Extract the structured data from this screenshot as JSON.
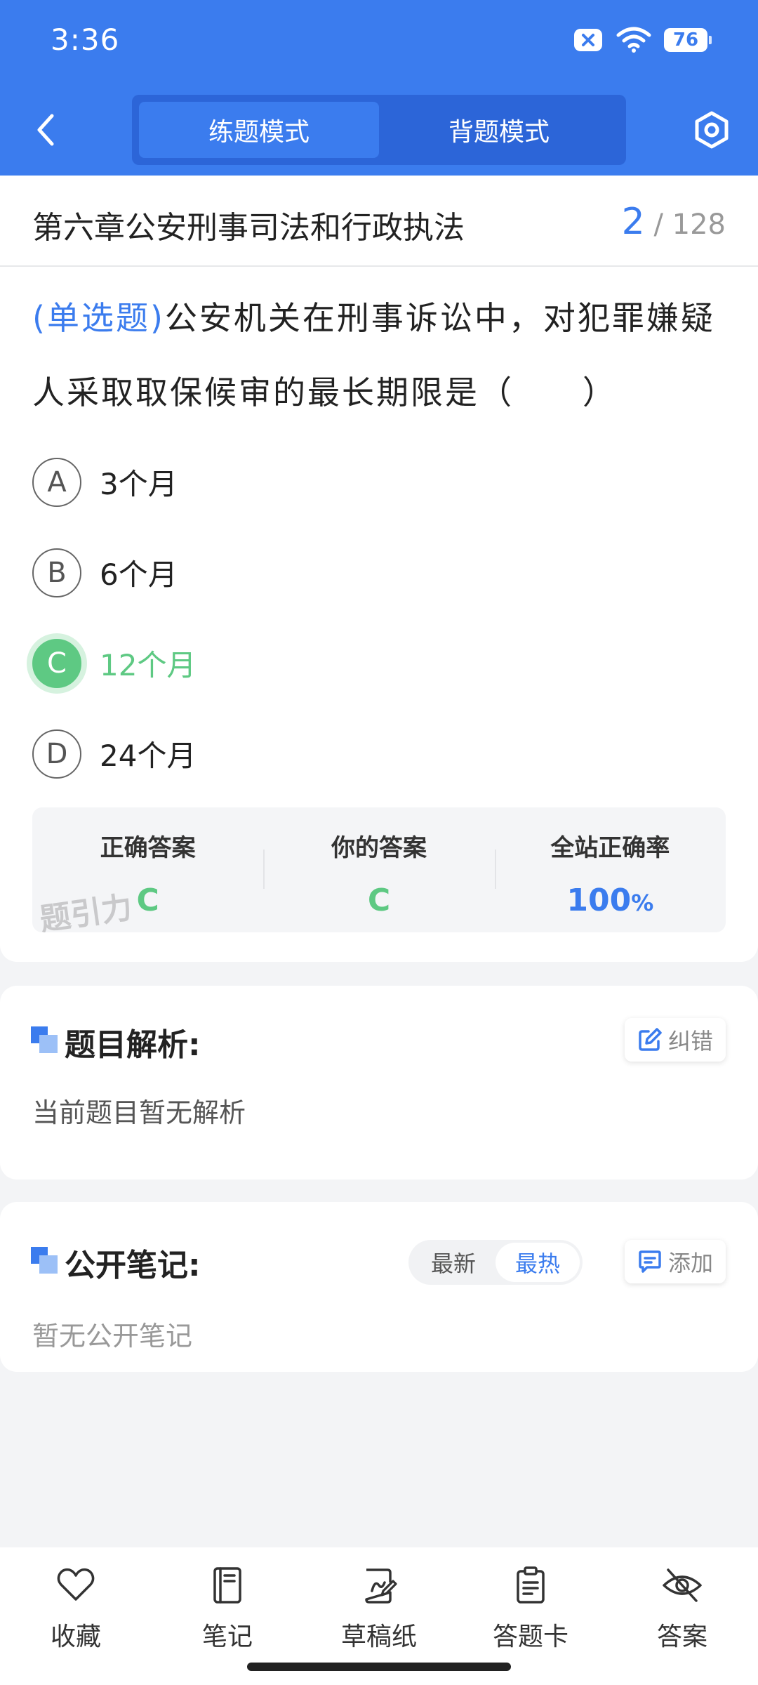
{
  "status_bar": {
    "time": "3:36",
    "battery": "76"
  },
  "header": {
    "modes": [
      {
        "label": "练题模式",
        "active": true
      },
      {
        "label": "背题模式",
        "active": false
      }
    ]
  },
  "question": {
    "chapter": "第六章公安刑事司法和行政执法",
    "current": "2",
    "total": "/ 128",
    "type": "(单选题)",
    "text": "公安机关在刑事诉讼中，对犯罪嫌疑人采取取保候审的最长期限是（　　）",
    "options": [
      {
        "letter": "A",
        "text": "3个月",
        "correct": false
      },
      {
        "letter": "B",
        "text": "6个月",
        "correct": false
      },
      {
        "letter": "C",
        "text": "12个月",
        "correct": true
      },
      {
        "letter": "D",
        "text": "24个月",
        "correct": false
      }
    ],
    "stats": {
      "correct_label": "正确答案",
      "correct_value": "C",
      "yours_label": "你的答案",
      "yours_value": "C",
      "rate_label": "全站正确率",
      "rate_value": "100",
      "rate_unit": "%"
    },
    "watermark": "题引力"
  },
  "analysis": {
    "title": "题目解析:",
    "report_label": "纠错",
    "body": "当前题目暂无解析"
  },
  "notes": {
    "title": "公开笔记:",
    "sort_options": [
      "最新",
      "最热"
    ],
    "sort_active": "最热",
    "add_label": "添加",
    "body": "暂无公开笔记"
  },
  "bottom_nav": [
    {
      "label": "收藏",
      "icon": "heart-icon"
    },
    {
      "label": "笔记",
      "icon": "notebook-icon"
    },
    {
      "label": "草稿纸",
      "icon": "draft-paper-icon"
    },
    {
      "label": "答题卡",
      "icon": "answer-sheet-icon"
    },
    {
      "label": "答案",
      "icon": "eye-off-icon"
    }
  ],
  "colors": {
    "primary": "#3b7cee",
    "correct": "#5ec983"
  }
}
